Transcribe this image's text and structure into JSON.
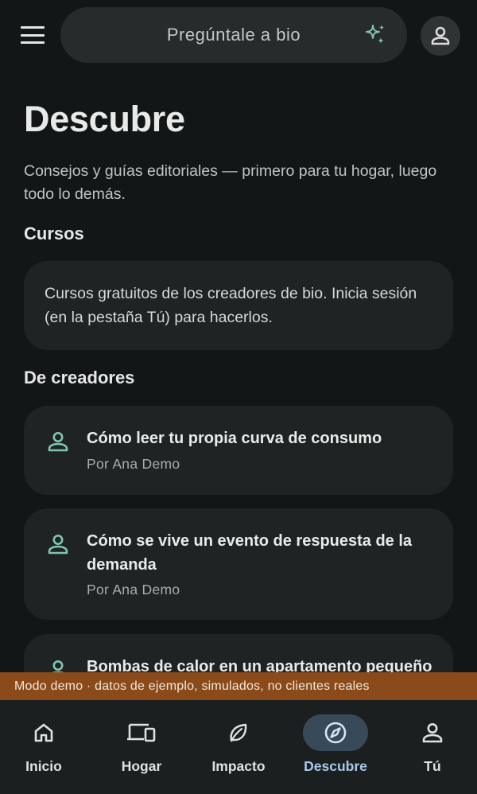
{
  "header": {
    "search_placeholder": "Pregúntale a bio",
    "menu_icon": "menu-icon",
    "assistant_icon": "sparkle-icon",
    "account_icon": "person-icon"
  },
  "page": {
    "title": "Descubre",
    "subtitle": "Consejos y guías editoriales — primero para tu hogar, luego todo lo demás."
  },
  "courses": {
    "heading": "Cursos",
    "info": "Cursos gratuitos de los creadores de bio. Inicia sesión (en la pestaña Tú) para hacerlos."
  },
  "creators": {
    "heading": "De creadores",
    "items": [
      {
        "title": "Cómo leer tu propia curva de consumo",
        "author": "Por Ana Demo"
      },
      {
        "title": "Cómo se vive un evento de respuesta de la demanda",
        "author": "Por Ana Demo"
      },
      {
        "title": "Bombas de calor en un apartamento pequeño",
        "author": ""
      }
    ]
  },
  "demo_banner": "Modo demo · datos de ejemplo, simulados, no clientes reales",
  "nav": {
    "items": [
      {
        "label": "Inicio",
        "icon": "home-icon"
      },
      {
        "label": "Hogar",
        "icon": "devices-icon"
      },
      {
        "label": "Impacto",
        "icon": "leaf-icon"
      },
      {
        "label": "Descubre",
        "icon": "compass-icon"
      },
      {
        "label": "Tú",
        "icon": "person-icon"
      }
    ],
    "active": "Descubre"
  },
  "colors": {
    "background": "#131616",
    "card": "#1f2323",
    "accent_teal": "#7fc6b0",
    "active_nav_pill": "#38495a",
    "active_nav_label": "#a8c9ec",
    "demo_banner": "#8a4a1a"
  }
}
